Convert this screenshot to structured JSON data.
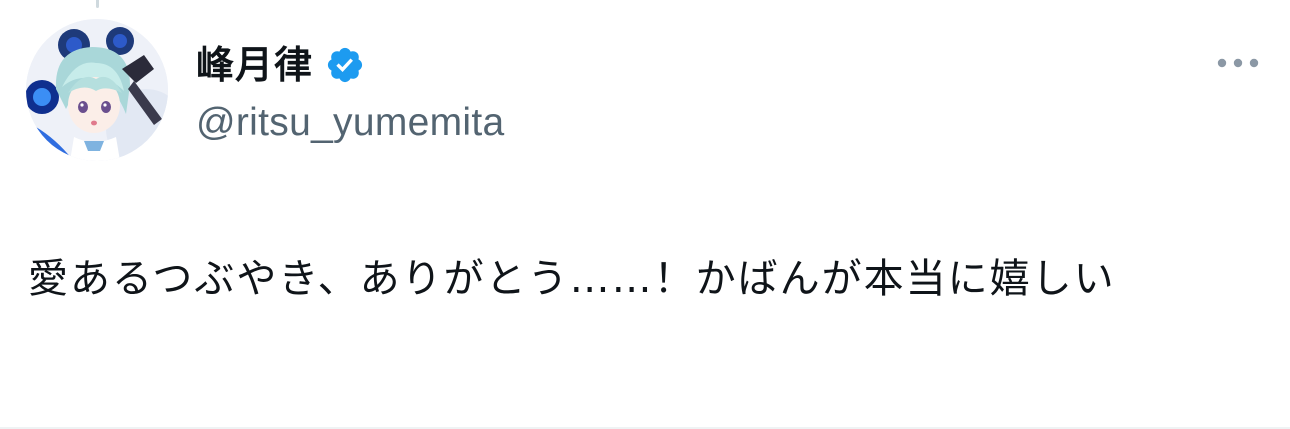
{
  "user": {
    "display_name": "峰月律",
    "handle": "@ritsu_yumemita",
    "verified": true,
    "verified_badge_icon": "verified-badge-icon",
    "avatar_icon": "avatar-anime-character"
  },
  "tweet": {
    "text": "愛あるつぶやき、ありがとう……！かばんが本当に嬉しい"
  },
  "actions": {
    "more_icon": "more-options-icon"
  },
  "colors": {
    "verified_blue": "#1d9bf0",
    "text_primary": "#0f1419",
    "text_secondary": "#536471",
    "divider": "#eff3f4"
  }
}
